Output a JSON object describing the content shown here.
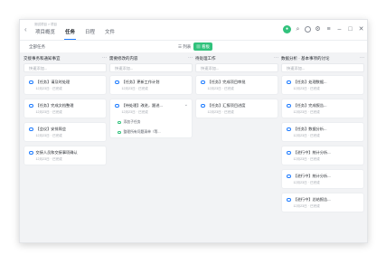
{
  "window": {
    "breadcrumb": "测试项目 > 项目",
    "tabs": [
      {
        "label": "项目概览",
        "active": false
      },
      {
        "label": "任务",
        "active": true
      },
      {
        "label": "日程",
        "active": false
      },
      {
        "label": "文件",
        "active": false
      }
    ],
    "icons": [
      "status-icon",
      "search-icon",
      "clock-icon",
      "settings-icon",
      "menu-icon",
      "minimize-icon",
      "maximize-icon",
      "close-icon"
    ]
  },
  "toolbar": {
    "todo_label": "全部任务",
    "list_mode": "列表",
    "board_mode": "看板"
  },
  "columns": [
    {
      "title": "交接事务和通知事宜",
      "add_placeholder": "快速添加...",
      "cards": [
        {
          "title": "【任务】请及时处理",
          "date": "12月23日 · 已完成"
        },
        {
          "title": "【任务】完成文档整理",
          "date": "12月23日 · 已完成"
        },
        {
          "title": "【会议】安排周会",
          "date": "12月23日 · 已完成"
        },
        {
          "title": "交接人员和交接事项确认",
          "date": "12月23日 · 已完成"
        }
      ]
    },
    {
      "title": "需要修改的内容",
      "add_placeholder": "快速添加...",
      "cards": [
        {
          "title": "【任务】更新工作计划",
          "date": "12月23日 · 已完成"
        },
        {
          "title": "【待处理】改进，跟进...",
          "date": "12月23日 · 已完成",
          "caret": "⌄",
          "subtasks": [
            "添加子任务",
            "整理所有问题清单（等..."
          ]
        }
      ]
    },
    {
      "title": "待处理工作",
      "add_placeholder": "快速添加...",
      "cards": [
        {
          "title": "【任务】完成项目审批",
          "date": "12月23日 · 已完成"
        },
        {
          "title": "【任务】汇报项目进度",
          "date": "12月23日 · 已完成"
        }
      ]
    },
    {
      "title": "数据分析 · 基本事项的讨论",
      "add_placeholder": "快速添加...",
      "cards": [
        {
          "title": "【任务】处理数据...",
          "date": "12月23日 · 已完成"
        },
        {
          "title": "【任务】完成报告...",
          "date": "12月23日 · 已完成"
        },
        {
          "title": "【任务】数据分析...",
          "date": "12月23日 · 已完成"
        },
        {
          "title": "【进行中】统计分析...",
          "date": "12月23日 · 已完成"
        },
        {
          "title": "【进行中】统计分析...",
          "date": "12月23日 · 已完成"
        },
        {
          "title": "【进行中】总结报告...",
          "date": "12月23日 · 已完成"
        }
      ]
    }
  ]
}
